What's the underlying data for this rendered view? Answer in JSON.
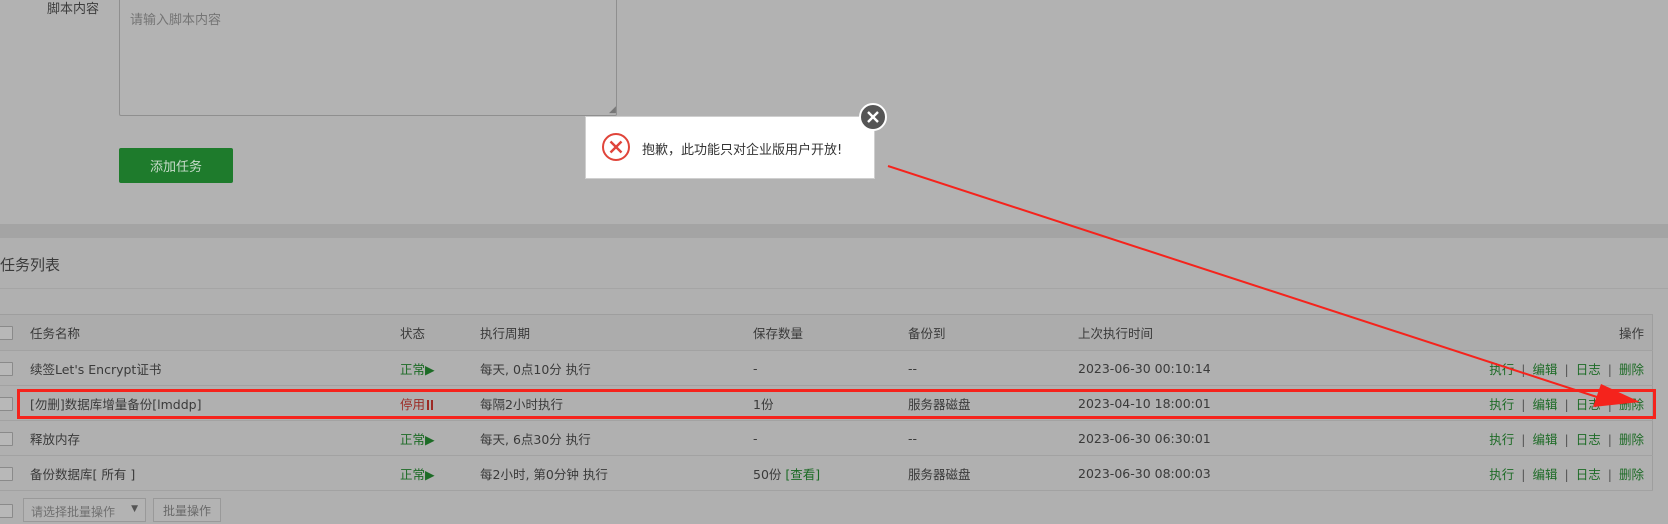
{
  "form": {
    "script_label": "脚本内容",
    "script_placeholder": "请输入脚本内容",
    "add_task_label": "添加任务"
  },
  "task_list": {
    "title": "任务列表",
    "columns": {
      "name": "任务名称",
      "status": "状态",
      "cycle": "执行周期",
      "retention": "保存数量",
      "backup_to": "备份到",
      "last_run": "上次执行时间",
      "ops": "操作"
    },
    "rows": [
      {
        "name": "续签Let's Encrypt证书",
        "status": "正常",
        "status_type": "ok",
        "cycle": "每天, 0点10分 执行",
        "retention": "-",
        "view": "",
        "backup_to": "--",
        "last_run": "2023-06-30 00:10:14"
      },
      {
        "name": "[勿删]数据库增量备份[lmddp]",
        "status": "停用",
        "status_type": "stopped",
        "cycle": "每隔2小时执行",
        "retention": "1份",
        "view": "",
        "backup_to": "服务器磁盘",
        "last_run": "2023-04-10 18:00:01"
      },
      {
        "name": "释放内存",
        "status": "正常",
        "status_type": "ok",
        "cycle": "每天, 6点30分 执行",
        "retention": "-",
        "view": "",
        "backup_to": "--",
        "last_run": "2023-06-30 06:30:01"
      },
      {
        "name": "备份数据库[ 所有 ]",
        "status": "正常",
        "status_type": "ok",
        "cycle": "每2小时, 第0分钟 执行",
        "retention": "50份",
        "view": "[查看]",
        "backup_to": "服务器磁盘",
        "last_run": "2023-06-30 08:00:03"
      }
    ],
    "actions": {
      "run": "执行",
      "edit": "编辑",
      "log": "日志",
      "delete": "删除",
      "separator": "|"
    },
    "batch_select_placeholder": "请选择批量操作",
    "batch_button": "批量操作"
  },
  "dialog": {
    "message": "抱歉，此功能只对企业版用户开放!",
    "icon": "error-x-icon",
    "close_icon": "close-icon"
  },
  "colors": {
    "ok_status": "#1d6b26",
    "stopped_status": "#9c2a25",
    "add_button": "#1e7b2c",
    "annotation_red": "#f5231c",
    "error_icon": "#e0443a"
  },
  "status_icons": {
    "ok": "play-icon",
    "stopped": "pause-icon"
  }
}
